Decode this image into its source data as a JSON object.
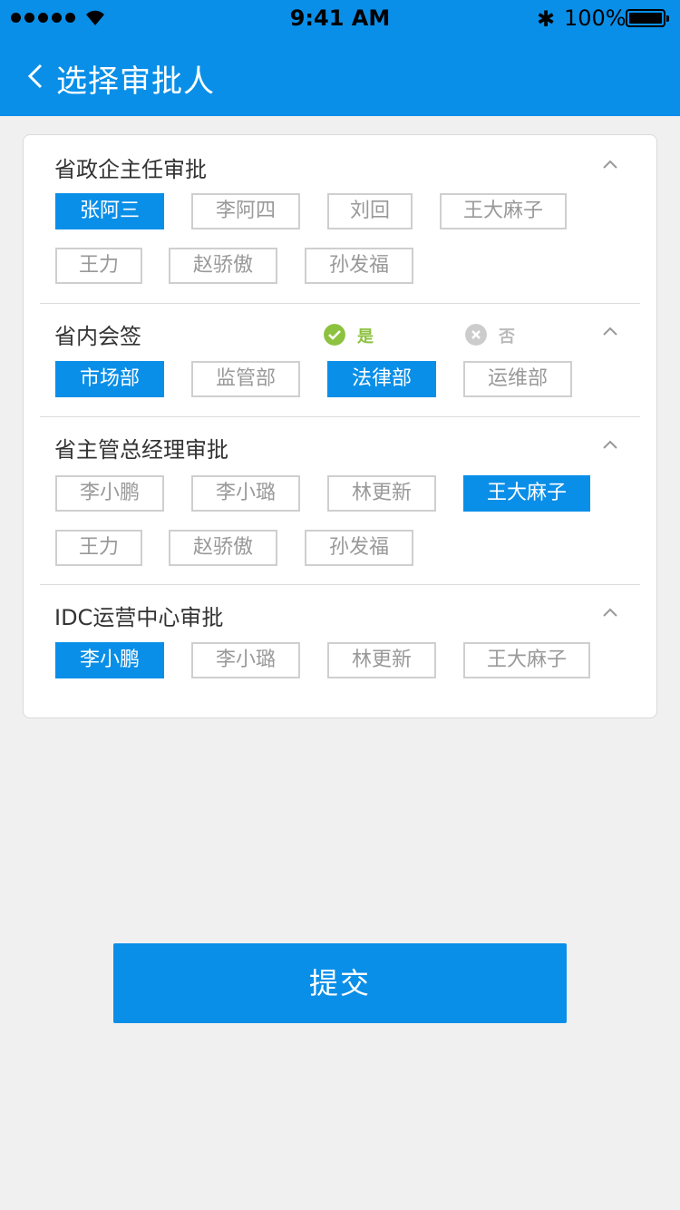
{
  "status_bar": {
    "time": "9:41 AM",
    "battery": "100%"
  },
  "nav": {
    "title": "选择审批人"
  },
  "sections": [
    {
      "title": "省政企主任审批",
      "tags": [
        "张阿三",
        "李阿四",
        "刘回",
        "王大麻子",
        "王力",
        "赵骄傲",
        "孙发福"
      ],
      "selected": [
        "张阿三"
      ]
    },
    {
      "title": "省内会签",
      "option_yes": "是",
      "option_no": "否",
      "tags": [
        "市场部",
        "监管部",
        "法律部",
        "运维部"
      ],
      "selected": [
        "市场部",
        "法律部"
      ]
    },
    {
      "title": "省主管总经理审批",
      "tags": [
        "李小鹏",
        "李小璐",
        "林更新",
        "王大麻子",
        "王力",
        "赵骄傲",
        "孙发福"
      ],
      "selected": [
        "王大麻子"
      ]
    },
    {
      "title": "IDC运营中心审批",
      "tags": [
        "李小鹏",
        "李小璐",
        "林更新",
        "王大麻子"
      ],
      "selected": [
        "李小鹏"
      ]
    }
  ],
  "submit_label": "提交",
  "colors": {
    "primary": "#0a8fe8",
    "yes": "#8cc23f",
    "no": "#cccccc"
  }
}
